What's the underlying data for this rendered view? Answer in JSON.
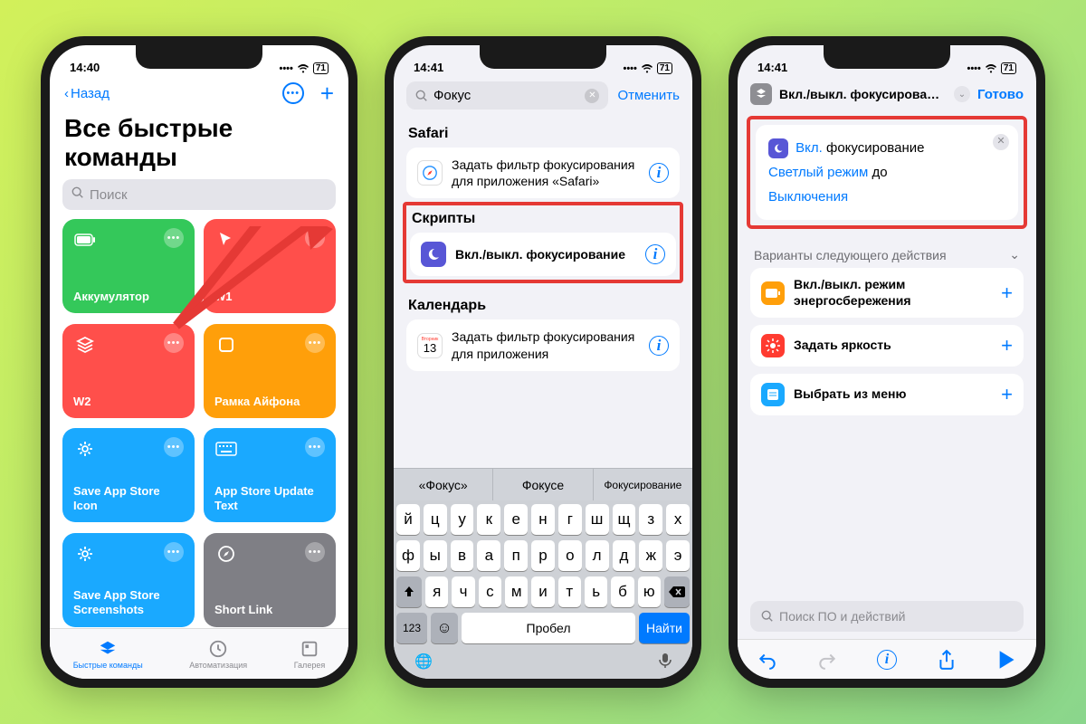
{
  "status": {
    "t1": "14:40",
    "t2": "14:41",
    "t3": "14:41",
    "battery": "71"
  },
  "p1": {
    "back": "Назад",
    "title": "Все быстрые команды",
    "search_ph": "Поиск",
    "tiles": [
      {
        "label": "Аккумулятор",
        "bg": "#34c85a"
      },
      {
        "label": "W1",
        "bg": "#ff4f4b"
      },
      {
        "label": "W2",
        "bg": "#ff4f4b"
      },
      {
        "label": "Рамка Айфона",
        "bg": "#ff9f0a"
      },
      {
        "label": "Save App Store Icon",
        "bg": "#1aa9ff"
      },
      {
        "label": "App Store Update Text",
        "bg": "#1aa9ff"
      },
      {
        "label": "Save App Store Screenshots",
        "bg": "#1aa9ff"
      },
      {
        "label": "Short Link",
        "bg": "#7f7f85"
      }
    ],
    "tabs": [
      "Быстрые команды",
      "Автоматизация",
      "Галерея"
    ]
  },
  "p2": {
    "query": "Фокус",
    "cancel": "Отменить",
    "sec_safari": "Safari",
    "safari_row": "Задать фильтр фокусирования для приложения «Safari»",
    "sec_scripts": "Скрипты",
    "scripts_row": "Вкл./выкл. фокусирование",
    "sec_cal": "Календарь",
    "cal_day": "13",
    "cal_wd": "Вторник",
    "cal_row": "Задать фильтр фокусирования для приложения",
    "sug": [
      "«Фокус»",
      "Фокусе",
      "Фокусирование"
    ],
    "rows": [
      [
        "й",
        "ц",
        "у",
        "к",
        "е",
        "н",
        "г",
        "ш",
        "щ",
        "з",
        "х"
      ],
      [
        "ф",
        "ы",
        "в",
        "а",
        "п",
        "р",
        "о",
        "л",
        "д",
        "ж",
        "э"
      ],
      [
        "я",
        "ч",
        "с",
        "м",
        "и",
        "т",
        "ь",
        "б",
        "ю"
      ]
    ],
    "k123": "123",
    "space": "Пробел",
    "find": "Найти"
  },
  "p3": {
    "title": "Вкл./выкл. фокусирован…",
    "done": "Готово",
    "act_on": "Вкл.",
    "act_focus": "фокусирование",
    "act_mode": "Светлый режим",
    "act_until": "до",
    "act_off": "Выключения",
    "sug_h": "Варианты следующего действия",
    "sugs": [
      {
        "label": "Вкл./выкл. режим энергосбережения",
        "bg": "#ff9f0a"
      },
      {
        "label": "Задать яркость",
        "bg": "#ff3b30"
      },
      {
        "label": "Выбрать из меню",
        "bg": "#1aa9ff"
      }
    ],
    "search_ph": "Поиск ПО и действий"
  }
}
